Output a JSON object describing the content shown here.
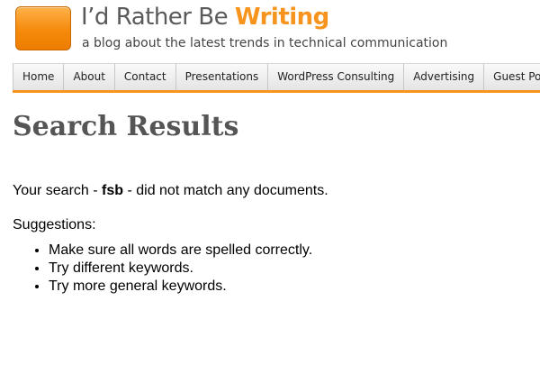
{
  "header": {
    "title_part1": "I’d Rather Be ",
    "title_part2": "Writing",
    "tagline": "a blog about the latest trends in technical communication",
    "logo_color": "#f7941d"
  },
  "nav": {
    "items": [
      "Home",
      "About",
      "Contact",
      "Presentations",
      "WordPress Consulting",
      "Advertising",
      "Guest Posts"
    ],
    "accent_color": "#f7941d"
  },
  "main": {
    "title": "Search Results",
    "message_prefix": "Your search - ",
    "search_term": "fsb",
    "message_suffix": " - did not match any documents.",
    "suggestions_label": "Suggestions:",
    "suggestions": [
      "Make sure all words are spelled correctly.",
      "Try different keywords.",
      "Try more general keywords."
    ]
  }
}
